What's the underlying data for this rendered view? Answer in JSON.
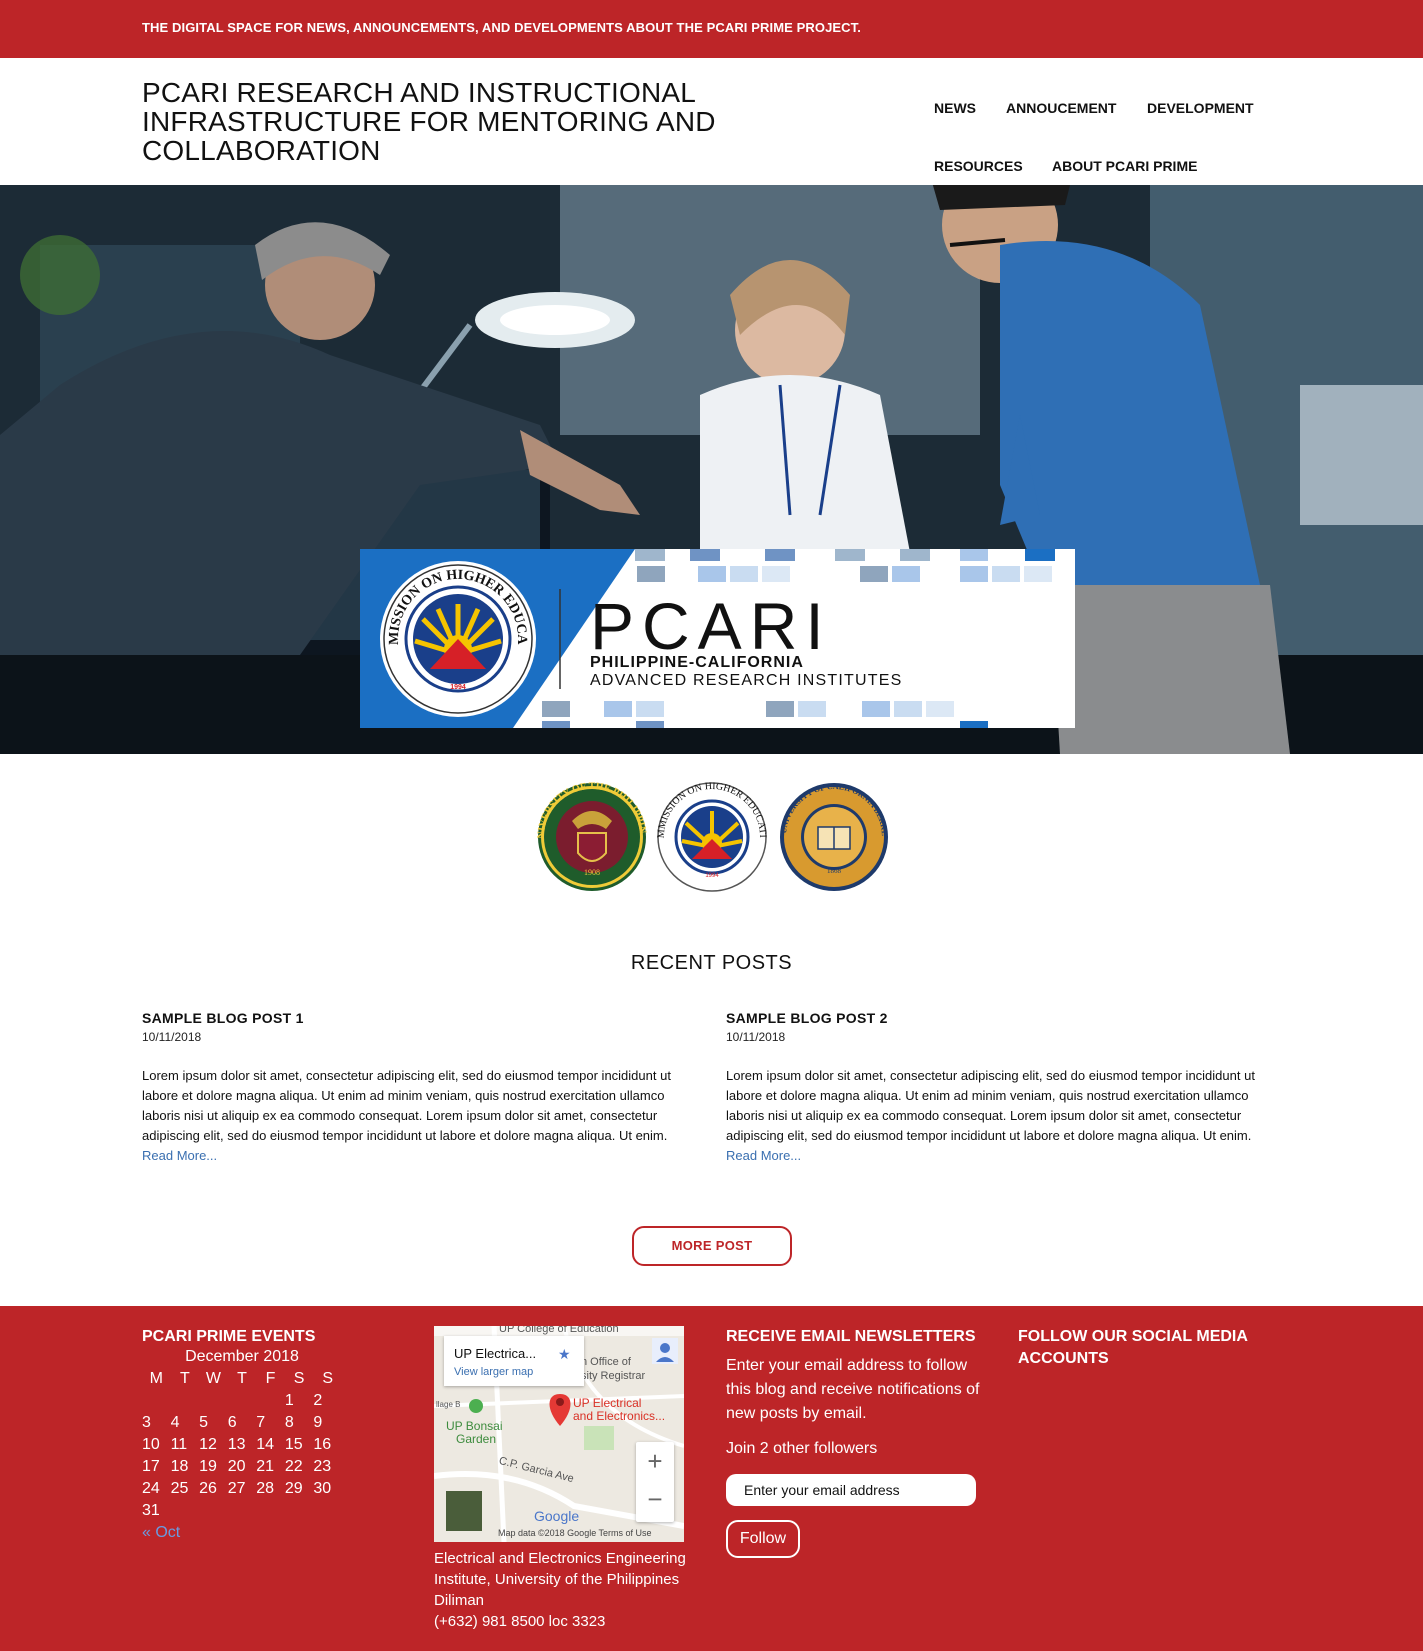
{
  "topbar": {
    "tagline": "THE DIGITAL SPACE FOR NEWS, ANNOUNCEMENTS, AND DEVELOPMENTS ABOUT THE PCARI PRIME PROJECT."
  },
  "header": {
    "title": "PCARI RESEARCH AND INSTRUCTIONAL INFRASTRUCTURE FOR MENTORING AND COLLABORATION",
    "nav": [
      "NEWS",
      "ANNOUCEMENT",
      "DEVELOPMENT",
      "RESOURCES",
      "ABOUT PCARI PRIME"
    ]
  },
  "hero": {
    "logo_word": "PCARI",
    "logo_line1": "PHILIPPINE-CALIFORNIA",
    "logo_line2": "ADVANCED RESEARCH INSTITUTES",
    "ched_seal_text": "COMMISSION ON HIGHER EDUCATION",
    "ched_seal_year": "1994"
  },
  "seals": {
    "up_text": "UNIVERSITY OF THE PHILIPPINES",
    "up_year": "1908",
    "ched_text": "COMMISSION ON HIGHER EDUCATION",
    "ched_year": "1994",
    "uc_text": "THE UNIVERSITY OF CALIFORNIA BERKELEY",
    "uc_year": "1868"
  },
  "recent": {
    "heading": "RECENT POSTS",
    "posts": [
      {
        "title": "SAMPLE BLOG POST 1",
        "date": "10/11/2018",
        "body": "Lorem ipsum dolor sit amet, consectetur adipiscing elit, sed do eiusmod tempor incididunt ut labore et dolore magna aliqua. Ut enim ad minim veniam, quis nostrud exercitation ullamco laboris nisi ut aliquip ex ea commodo consequat. Lorem ipsum dolor sit amet, consectetur adipiscing elit, sed do eiusmod tempor incididunt ut labore et dolore magna aliqua. Ut enim.",
        "read_more": "Read More..."
      },
      {
        "title": "SAMPLE BLOG POST 2",
        "date": "10/11/2018",
        "body": "Lorem ipsum dolor sit amet, consectetur adipiscing elit, sed do eiusmod tempor incididunt ut labore et dolore magna aliqua. Ut enim ad minim veniam, quis nostrud exercitation ullamco laboris nisi ut aliquip ex ea commodo consequat. Lorem ipsum dolor sit amet, consectetur adipiscing elit, sed do eiusmod tempor incididunt ut labore et dolore magna aliqua. Ut enim.",
        "read_more": "Read More..."
      }
    ],
    "more_button": "MORE POST"
  },
  "footer": {
    "events": {
      "heading": "PCARI PRIME EVENTS",
      "month": "December 2018",
      "weekdays": [
        "M",
        "T",
        "W",
        "T",
        "F",
        "S",
        "S"
      ],
      "weeks": [
        [
          "",
          "",
          "",
          "",
          "",
          "1",
          "2"
        ],
        [
          "3",
          "4",
          "5",
          "6",
          "7",
          "8",
          "9"
        ],
        [
          "10",
          "11",
          "12",
          "13",
          "14",
          "15",
          "16"
        ],
        [
          "17",
          "18",
          "19",
          "20",
          "21",
          "22",
          "23"
        ],
        [
          "24",
          "25",
          "26",
          "27",
          "28",
          "29",
          "30"
        ],
        [
          "31",
          "",
          "",
          "",
          "",
          "",
          ""
        ]
      ],
      "prev": "« Oct"
    },
    "map": {
      "place_name": "UP Electrica...",
      "larger_map": "View larger map",
      "label_college": "UP College of Education",
      "label_registrar1": "n Office of",
      "label_registrar2": "sity Registrar",
      "label_village": "llage B",
      "label_bonsai1": "UP Bonsai",
      "label_bonsai2": "Garden",
      "label_pin1": "UP Electrical",
      "label_pin2": "and Electronics...",
      "label_street": "C.P. Garcia Ave",
      "label_google": "Google",
      "attribution": "Map data ©2018 Google   Terms of Use",
      "zoom_in": "+",
      "zoom_out": "−",
      "address_line": "Electrical and Electronics Engineering Institute, University of the Philippines Diliman",
      "phone": "(+632) 981 8500 loc 3323"
    },
    "newsletter": {
      "heading": "RECEIVE EMAIL NEWSLETTERS",
      "text": "Enter your email address to follow this blog and receive notifications of new posts by email.",
      "join": "Join 2 other followers",
      "placeholder": "Enter your email address",
      "button": "Follow"
    },
    "social": {
      "heading": "FOLLOW OUR SOCIAL MEDIA ACCOUNTS"
    }
  },
  "colors": {
    "brand_red": "#bd2528",
    "link_blue": "#3a6fb0",
    "logo_blue": "#1b6fc3"
  }
}
